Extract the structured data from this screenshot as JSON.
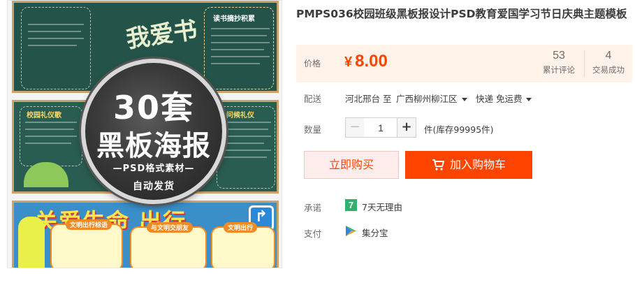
{
  "product": {
    "title": "PMPS036校园班级黑板报设计PSD教育爱国学习节日庆典主题模板"
  },
  "image": {
    "badge_count": "30套",
    "badge_title": "黑板海报",
    "badge_format": "—PSD格式素材—",
    "badge_delivery": "自动发货",
    "poster1_text": "我爱书",
    "poster1_panel_title": "读书摘抄积累",
    "poster2_panel_left": "校园礼仪歌",
    "poster2_panel_right": "问候礼仪",
    "poster3_headline": "关爱生命 出行",
    "poster3_box1": "文明出行标语",
    "poster3_box2": "与文明交朋友",
    "poster3_box3": "文明出行"
  },
  "price": {
    "label": "价格",
    "currency": "¥",
    "amount": "8.00"
  },
  "stats": {
    "reviews_count": "53",
    "reviews_label": "累计评论",
    "sales_count": "4",
    "sales_label": "交易成功"
  },
  "shipping": {
    "label": "配送",
    "from": "河北邢台 至",
    "to": "广西柳州柳江区",
    "method": "快递 免运费"
  },
  "quantity": {
    "label": "数量",
    "minus": "−",
    "value": "1",
    "plus": "+",
    "stock": "件(库存99995件)"
  },
  "actions": {
    "buy_now": "立即购买",
    "add_to_cart": "加入购物车"
  },
  "promise": {
    "label": "承诺",
    "icon_text": "7",
    "text": "7天无理由"
  },
  "payment": {
    "label": "支付",
    "text": "集分宝"
  },
  "colors": {
    "accent": "#ff4400",
    "price_bg": "#fff2e8",
    "buy_bg": "#ffeded",
    "promise_green": "#2db36b",
    "chalkboard": "#24534a"
  }
}
